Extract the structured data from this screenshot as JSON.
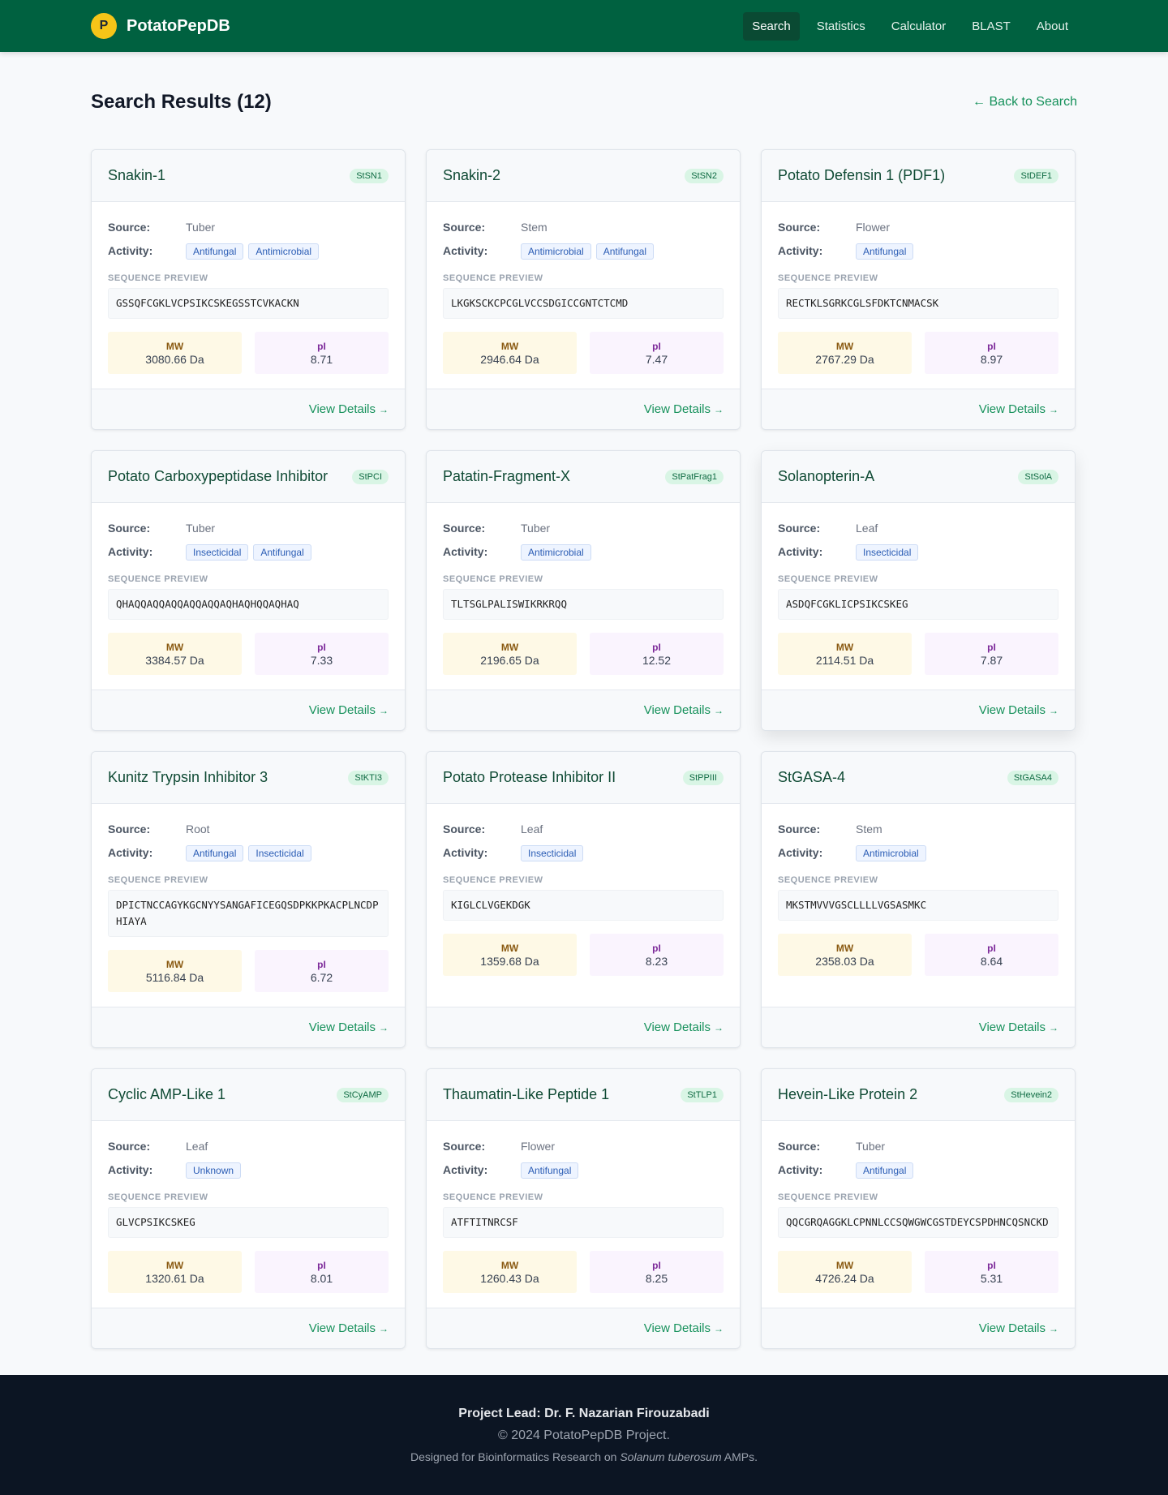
{
  "header": {
    "logo_letter": "P",
    "brand": "PotatoPepDB",
    "nav": [
      {
        "label": "Search",
        "active": true
      },
      {
        "label": "Statistics",
        "active": false
      },
      {
        "label": "Calculator",
        "active": false
      },
      {
        "label": "BLAST",
        "active": false
      },
      {
        "label": "About",
        "active": false
      }
    ]
  },
  "main": {
    "title": "Search Results (12)",
    "back_link": "← Back to Search",
    "labels": {
      "source": "Source:",
      "activity": "Activity:",
      "sequence_preview": "SEQUENCE PREVIEW",
      "mw": "MW",
      "pi": "pI",
      "view_details": "View Details",
      "arrow": "→"
    },
    "cards": [
      {
        "title": "Snakin-1",
        "badge": "StSN1",
        "source": "Tuber",
        "activity": [
          "Antifungal",
          "Antimicrobial"
        ],
        "sequence": "GSSQFCGKLVCPSIKCSKEGSSTCVKACKN",
        "mw": "3080.66 Da",
        "pi": "8.71"
      },
      {
        "title": "Snakin-2",
        "badge": "StSN2",
        "source": "Stem",
        "activity": [
          "Antimicrobial",
          "Antifungal"
        ],
        "sequence": "LKGKSCKCPCGLVCCSDGICCGNTCTCMD",
        "mw": "2946.64 Da",
        "pi": "7.47"
      },
      {
        "title": "Potato Defensin 1 (PDF1)",
        "badge": "StDEF1",
        "source": "Flower",
        "activity": [
          "Antifungal"
        ],
        "sequence": "RECTKLSGRKCGLSFDKTCNMACSK",
        "mw": "2767.29 Da",
        "pi": "8.97"
      },
      {
        "title": "Potato Carboxypeptidase Inhibitor",
        "badge": "StPCI",
        "source": "Tuber",
        "activity": [
          "Insecticidal",
          "Antifungal"
        ],
        "sequence": "QHAQQAQQAQQAQQAQQAQHAQHQQAQHAQ",
        "mw": "3384.57 Da",
        "pi": "7.33"
      },
      {
        "title": "Patatin-Fragment-X",
        "badge": "StPatFrag1",
        "source": "Tuber",
        "activity": [
          "Antimicrobial"
        ],
        "sequence": "TLTSGLPALISWIKRKRQQ",
        "mw": "2196.65 Da",
        "pi": "12.52"
      },
      {
        "title": "Solanopterin-A",
        "badge": "StSolA",
        "source": "Leaf",
        "activity": [
          "Insecticidal"
        ],
        "sequence": "ASDQFCGKLICPSIKCSKEG",
        "mw": "2114.51 Da",
        "pi": "7.87",
        "elevated": true
      },
      {
        "title": "Kunitz Trypsin Inhibitor 3",
        "badge": "StKTI3",
        "source": "Root",
        "activity": [
          "Antifungal",
          "Insecticidal"
        ],
        "sequence": "DPICTNCCAGYKGCNYYSANGAFICEGQSDPKKPKACPLNCDPHIAYA",
        "mw": "5116.84 Da",
        "pi": "6.72"
      },
      {
        "title": "Potato Protease Inhibitor II",
        "badge": "StPPIII",
        "source": "Leaf",
        "activity": [
          "Insecticidal"
        ],
        "sequence": "KIGLCLVGEKDGK",
        "mw": "1359.68 Da",
        "pi": "8.23"
      },
      {
        "title": "StGASA-4",
        "badge": "StGASA4",
        "source": "Stem",
        "activity": [
          "Antimicrobial"
        ],
        "sequence": "MKSTMVVVGSCLLLLVGSASMKC",
        "mw": "2358.03 Da",
        "pi": "8.64"
      },
      {
        "title": "Cyclic AMP-Like 1",
        "badge": "StCyAMP",
        "source": "Leaf",
        "activity": [
          "Unknown"
        ],
        "sequence": "GLVCPSIKCSKEG",
        "mw": "1320.61 Da",
        "pi": "8.01"
      },
      {
        "title": "Thaumatin-Like Peptide 1",
        "badge": "StTLP1",
        "source": "Flower",
        "activity": [
          "Antifungal"
        ],
        "sequence": "ATFTITNRCSF",
        "mw": "1260.43 Da",
        "pi": "8.25"
      },
      {
        "title": "Hevein-Like Protein 2",
        "badge": "StHevein2",
        "source": "Tuber",
        "activity": [
          "Antifungal"
        ],
        "sequence": "QQCGRQAGGKLCPNNLCCSQWGWCGSTDEYCSPDHNCQSNCKD",
        "mw": "4726.24 Da",
        "pi": "5.31"
      }
    ]
  },
  "footer": {
    "lead": "Project Lead: Dr. F. Nazarian Firouzabadi",
    "copyright": "© 2024 PotatoPepDB Project.",
    "note_prefix": "Designed for Bioinformatics Research on",
    "note_species": "Solanum tuberosum",
    "note_suffix": "AMPs."
  },
  "colors": {
    "header_bg": "#006140",
    "accent": "#16915b",
    "footer_bg": "#0c1523"
  }
}
